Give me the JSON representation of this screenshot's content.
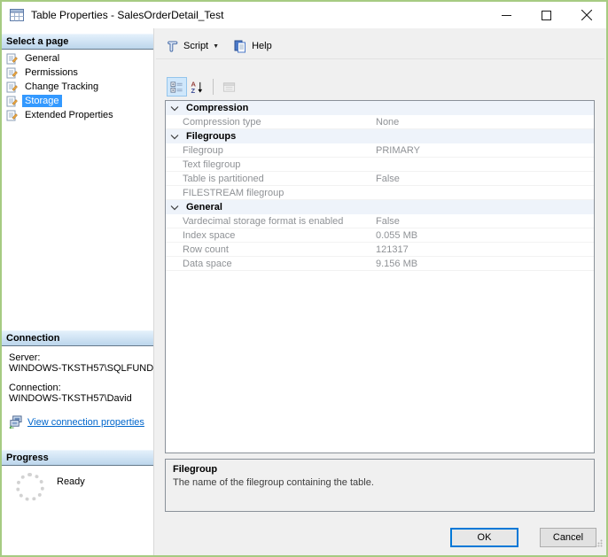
{
  "window": {
    "title": "Table Properties - SalesOrderDetail_Test"
  },
  "sidebar": {
    "select_page": {
      "header": "Select a page",
      "items": [
        {
          "label": "General",
          "selected": false
        },
        {
          "label": "Permissions",
          "selected": false
        },
        {
          "label": "Change Tracking",
          "selected": false
        },
        {
          "label": "Storage",
          "selected": true
        },
        {
          "label": "Extended Properties",
          "selected": false
        }
      ]
    },
    "connection": {
      "header": "Connection",
      "server_label": "Server:",
      "server_value": "WINDOWS-TKSTH57\\SQLFUND",
      "connection_label": "Connection:",
      "connection_value": "WINDOWS-TKSTH57\\David",
      "link_label": "View connection properties"
    },
    "progress": {
      "header": "Progress",
      "status": "Ready"
    }
  },
  "toolbar": {
    "script_label": "Script",
    "help_label": "Help"
  },
  "property_grid": {
    "rows": [
      {
        "type": "category",
        "label": "Compression"
      },
      {
        "type": "property",
        "label": "Compression type",
        "value": "None"
      },
      {
        "type": "category",
        "label": "Filegroups"
      },
      {
        "type": "property",
        "label": "Filegroup",
        "value": "PRIMARY"
      },
      {
        "type": "property",
        "label": "Text filegroup",
        "value": ""
      },
      {
        "type": "property",
        "label": "Table is partitioned",
        "value": "False"
      },
      {
        "type": "property",
        "label": "FILESTREAM filegroup",
        "value": ""
      },
      {
        "type": "category",
        "label": "General"
      },
      {
        "type": "property",
        "label": "Vardecimal storage format is enabled",
        "value": "False"
      },
      {
        "type": "property",
        "label": "Index space",
        "value": "0.055 MB"
      },
      {
        "type": "property",
        "label": "Row count",
        "value": "121317"
      },
      {
        "type": "property",
        "label": "Data space",
        "value": "9.156 MB"
      }
    ]
  },
  "description": {
    "title": "Filegroup",
    "text": "The name of the filegroup containing the table."
  },
  "footer": {
    "ok_label": "OK",
    "cancel_label": "Cancel"
  },
  "colors": {
    "selection_blue": "#3399ff",
    "link_blue": "#0066cc",
    "outer_border_green": "#a6cb82",
    "category_row_bg": "#eef3fa",
    "grid_text_gray": "#8f9296",
    "focus_border_blue": "#0078d7"
  },
  "icons": {
    "titlebar": "table-icon",
    "window_controls": [
      "minimize-icon",
      "maximize-icon",
      "close-icon"
    ],
    "sidebar_item": "page-script-icon",
    "connection_link": "network-connection-icon",
    "progress": "spinner-icon",
    "toolbar": [
      "script-scroll-icon",
      "help-book-icon"
    ],
    "grid_toolbar": [
      "categorized-icon",
      "alphabetical-sort-icon",
      "property-pages-icon"
    ]
  }
}
